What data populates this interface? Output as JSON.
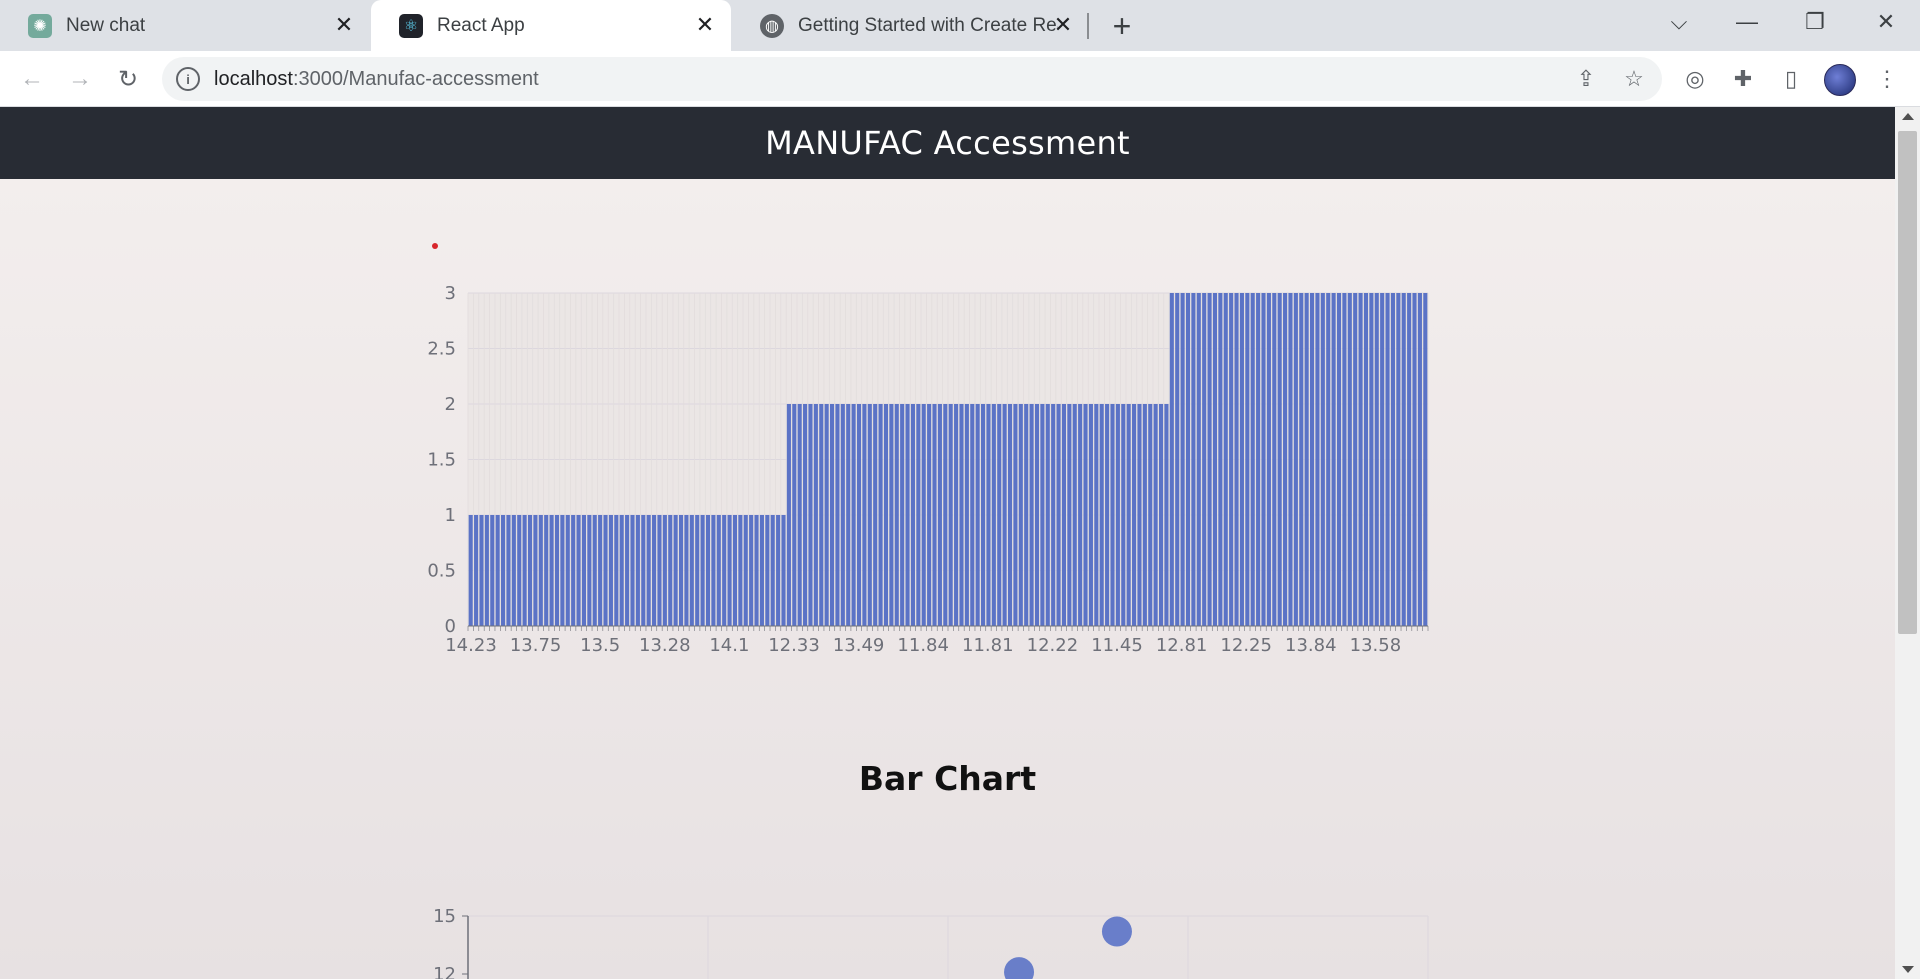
{
  "browser": {
    "tabs": [
      {
        "title": "New chat",
        "icon": "openai-icon"
      },
      {
        "title": "React App",
        "icon": "react-icon"
      },
      {
        "title": "Getting Started with Create React",
        "icon": "globe-icon"
      }
    ],
    "url_host": "localhost",
    "url_path": ":3000/Manufac-accessment"
  },
  "app": {
    "header_title": "MANUFAC Accessment",
    "bar_section_title": "Bar Chart",
    "accent_color": "#5b73c6",
    "header_bg": "#282c34"
  },
  "chart_data": [
    {
      "type": "bar",
      "title": "",
      "xlabel": "",
      "ylabel": "",
      "ylim": [
        0,
        3
      ],
      "yticks": [
        "0",
        "0.5",
        "1",
        "1.5",
        "2",
        "2.5",
        "3"
      ],
      "x_tick_labels": [
        "14.23",
        "13.75",
        "13.5",
        "13.28",
        "14.1",
        "12.33",
        "13.49",
        "11.84",
        "11.81",
        "12.22",
        "11.45",
        "12.81",
        "12.25",
        "13.84",
        "13.58"
      ],
      "series": [
        {
          "values_by_segment": [
            {
              "count": 59,
              "value": 1
            },
            {
              "count": 71,
              "value": 2
            },
            {
              "count": 48,
              "value": 3
            }
          ]
        }
      ],
      "grid": true
    },
    {
      "type": "scatter",
      "ylim_visible_top": 15,
      "yticks_visible": [
        "15",
        "12"
      ],
      "points_visible": [
        {
          "x_fraction": 0.574,
          "y": 12.1
        },
        {
          "x_fraction": 0.676,
          "y": 14.2
        }
      ]
    }
  ]
}
